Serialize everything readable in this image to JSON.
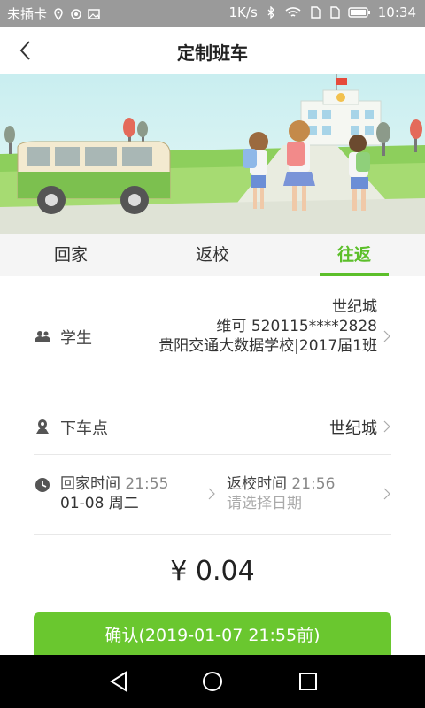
{
  "status_bar": {
    "carrier": "未插卡",
    "speed": "1K/s",
    "time": "10:34",
    "icons": [
      "location-icon",
      "eye-icon",
      "image-icon",
      "bluetooth-icon",
      "wifi-icon",
      "sim-icon",
      "sim-icon",
      "battery-icon"
    ]
  },
  "header": {
    "title": "定制班车"
  },
  "tabs": [
    {
      "label": "回家",
      "active": false
    },
    {
      "label": "返校",
      "active": false
    },
    {
      "label": "往返",
      "active": true
    }
  ],
  "student": {
    "label": "学生",
    "line1": "世纪城",
    "line2": "维可 520115****2828",
    "line3": "贵阳交通大数据学校|2017届1班"
  },
  "stop": {
    "label": "下车点",
    "value": "世纪城"
  },
  "times": {
    "home_label": "回家时间",
    "home_time": "21:55",
    "home_date": "01-08 周二",
    "return_label": "返校时间",
    "return_time": "21:56",
    "return_placeholder": "请选择日期"
  },
  "price": "¥ 0.04",
  "confirm_label": "确认(2019-01-07 21:55前)",
  "colors": {
    "accent": "#5cbf2a",
    "button": "#6ac72f",
    "status_bar": "#9a9a9a"
  }
}
